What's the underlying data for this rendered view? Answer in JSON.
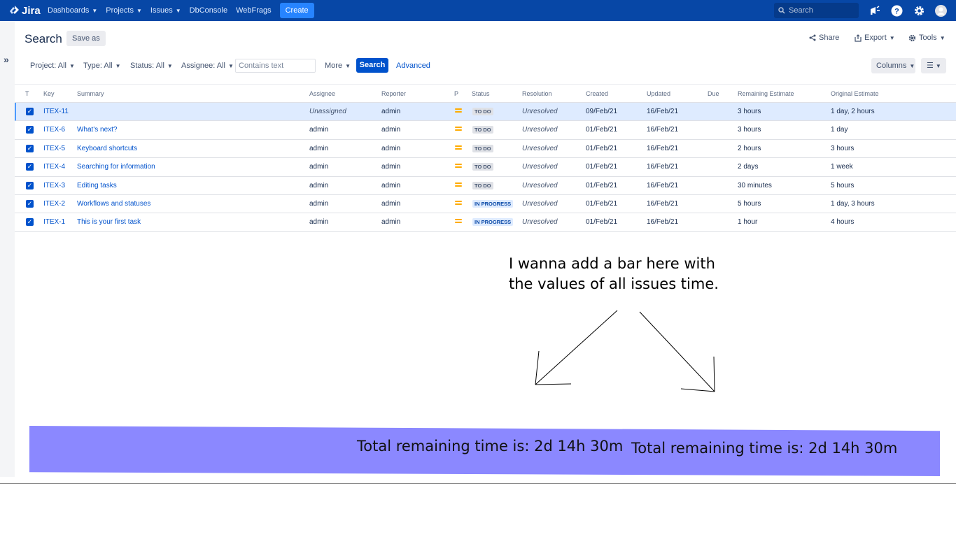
{
  "nav": {
    "logo": "Jira",
    "items": [
      {
        "label": "Dashboards",
        "caret": true
      },
      {
        "label": "Projects",
        "caret": true
      },
      {
        "label": "Issues",
        "caret": true
      },
      {
        "label": "DbConsole",
        "caret": false
      },
      {
        "label": "WebFrags",
        "caret": false
      }
    ],
    "create": "Create",
    "search_placeholder": "Search",
    "brand_color": "#0747a6"
  },
  "page": {
    "title": "Search",
    "save_as": "Save as",
    "share": "Share",
    "export": "Export",
    "tools": "Tools"
  },
  "filters": {
    "project": "Project: All",
    "type": "Type: All",
    "status": "Status: All",
    "assignee": "Assignee: All",
    "text_placeholder": "Contains text",
    "more": "More",
    "search_button": "Search",
    "advanced": "Advanced",
    "columns": "Columns"
  },
  "table": {
    "headers": [
      "T",
      "Key",
      "Summary",
      "Assignee",
      "Reporter",
      "P",
      "Status",
      "Resolution",
      "Created",
      "Updated",
      "Due",
      "Remaining Estimate",
      "Original Estimate"
    ],
    "rows": [
      {
        "key": "ITEX-11",
        "summary": "",
        "assignee": "Unassigned",
        "reporter": "admin",
        "status": "TO DO",
        "status_type": "todo",
        "resolution": "Unresolved",
        "created": "09/Feb/21",
        "updated": "16/Feb/21",
        "due": "",
        "remaining": "3 hours",
        "original": "1 day, 2 hours"
      },
      {
        "key": "ITEX-6",
        "summary": "What's next?",
        "assignee": "admin",
        "reporter": "admin",
        "status": "TO DO",
        "status_type": "todo",
        "resolution": "Unresolved",
        "created": "01/Feb/21",
        "updated": "16/Feb/21",
        "due": "",
        "remaining": "3 hours",
        "original": "1 day"
      },
      {
        "key": "ITEX-5",
        "summary": "Keyboard shortcuts",
        "assignee": "admin",
        "reporter": "admin",
        "status": "TO DO",
        "status_type": "todo",
        "resolution": "Unresolved",
        "created": "01/Feb/21",
        "updated": "16/Feb/21",
        "due": "",
        "remaining": "2 hours",
        "original": "3 hours"
      },
      {
        "key": "ITEX-4",
        "summary": "Searching for information",
        "assignee": "admin",
        "reporter": "admin",
        "status": "TO DO",
        "status_type": "todo",
        "resolution": "Unresolved",
        "created": "01/Feb/21",
        "updated": "16/Feb/21",
        "due": "",
        "remaining": "2 days",
        "original": "1 week"
      },
      {
        "key": "ITEX-3",
        "summary": "Editing tasks",
        "assignee": "admin",
        "reporter": "admin",
        "status": "TO DO",
        "status_type": "todo",
        "resolution": "Unresolved",
        "created": "01/Feb/21",
        "updated": "16/Feb/21",
        "due": "",
        "remaining": "30 minutes",
        "original": "5 hours"
      },
      {
        "key": "ITEX-2",
        "summary": "Workflows and statuses",
        "assignee": "admin",
        "reporter": "admin",
        "status": "IN PROGRESS",
        "status_type": "inprogress",
        "resolution": "Unresolved",
        "created": "01/Feb/21",
        "updated": "16/Feb/21",
        "due": "",
        "remaining": "5 hours",
        "original": "1 day, 3 hours"
      },
      {
        "key": "ITEX-1",
        "summary": "This is your first task",
        "assignee": "admin",
        "reporter": "admin",
        "status": "IN PROGRESS",
        "status_type": "inprogress",
        "resolution": "Unresolved",
        "created": "01/Feb/21",
        "updated": "16/Feb/21",
        "due": "",
        "remaining": "1 hour",
        "original": "4 hours"
      }
    ]
  },
  "annotation": {
    "note": "I wanna add a bar here with the values of all issues time.",
    "total_left": "Total remaining time is: 2d 14h 30m",
    "total_right": "Total remaining time is: 2d 14h 30m",
    "bar_color": "#8b88ff"
  }
}
